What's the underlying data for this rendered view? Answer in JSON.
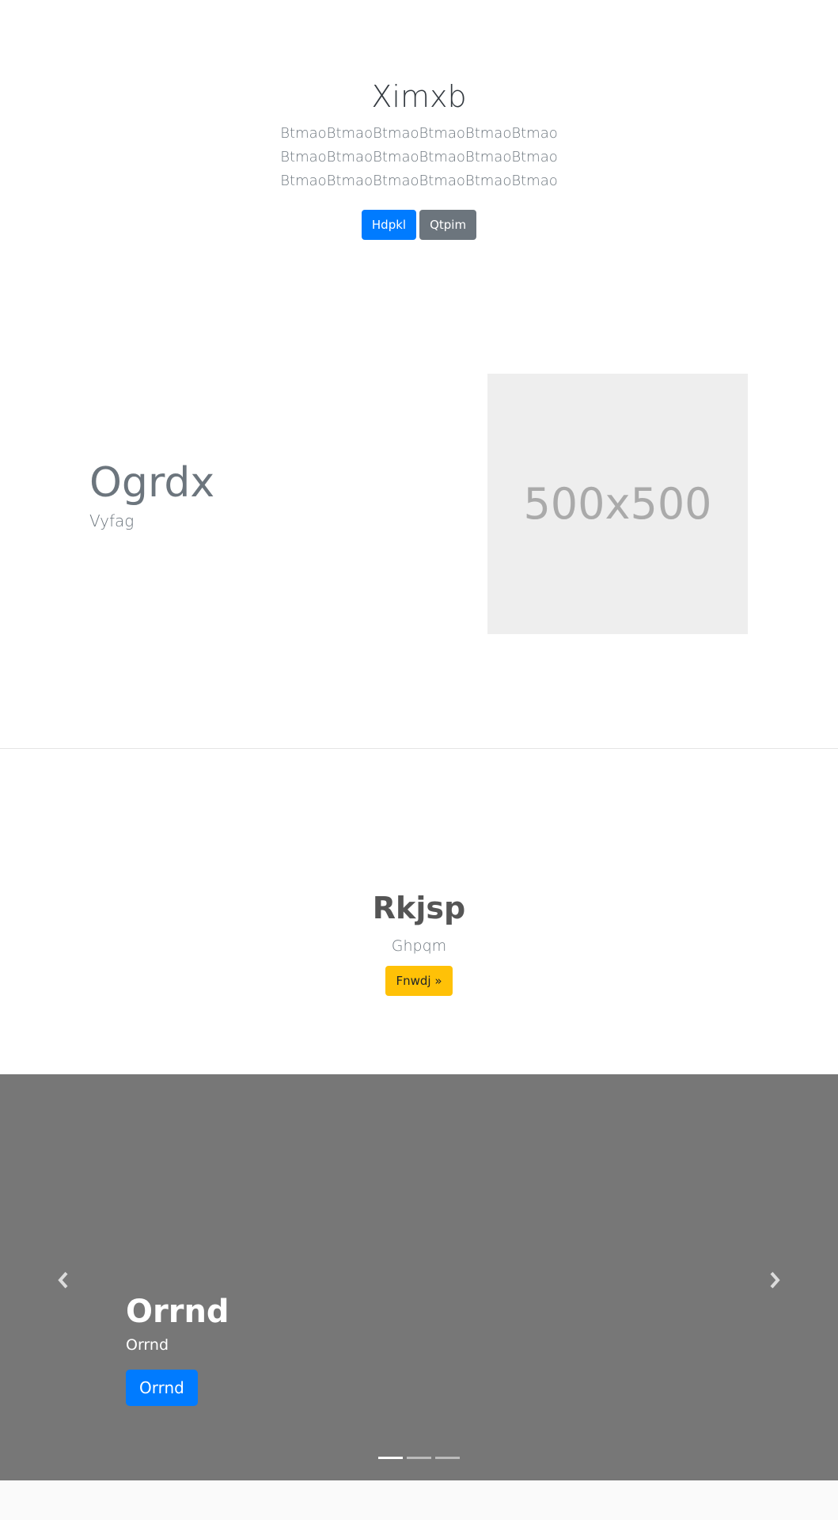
{
  "hero": {
    "title": "Ximxb",
    "lead_lines": [
      "BtmaoBtmaoBtmaoBtmaoBtmaoBtmao",
      "BtmaoBtmaoBtmaoBtmaoBtmaoBtmao",
      "BtmaoBtmaoBtmaoBtmaoBtmaoBtmao"
    ],
    "primary_button": "Hdpkl",
    "secondary_button": "Qtpim"
  },
  "feature": {
    "title": "Ogrdx",
    "subtitle": "Vyfag",
    "image_placeholder": "500x500"
  },
  "cta": {
    "title": "Rkjsp",
    "text": "Ghpqm",
    "button": "Fnwdj »"
  },
  "carousel": {
    "prev_icon": "chevron-left-icon",
    "next_icon": "chevron-right-icon",
    "caption_title": "Orrnd",
    "caption_text": "Orrnd",
    "caption_button": "Orrnd",
    "slide_count": 3,
    "active_slide": 1
  },
  "colors": {
    "primary": "#007bff",
    "secondary": "#6c757d",
    "warning": "#ffc107",
    "carousel_bg": "#777777"
  }
}
